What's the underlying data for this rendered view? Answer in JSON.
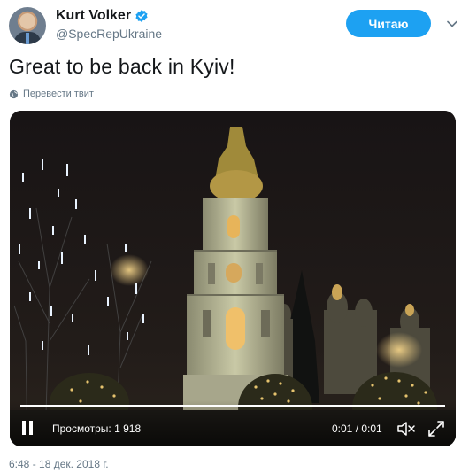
{
  "author": {
    "name": "Kurt Volker",
    "handle": "@SpecRepUkraine",
    "verified": true
  },
  "follow_button": {
    "label": "Читаю"
  },
  "tweet": {
    "text": "Great to be back in Kyiv!",
    "translate_label": "Перевести твит",
    "timestamp": "6:48 - 18 дек. 2018 г."
  },
  "video": {
    "views_label": "Просмотры: 1 918",
    "timecode": "0:01 / 0:01",
    "progress": 1.0
  },
  "icons": {
    "verified": "verified-badge-icon",
    "chevron": "chevron-down-icon",
    "globe": "globe-icon",
    "pause": "pause-icon",
    "mute": "muted-speaker-icon",
    "fullscreen": "expand-icon"
  },
  "colors": {
    "accent": "#1da1f2",
    "text": "#14171a",
    "muted": "#657786"
  }
}
